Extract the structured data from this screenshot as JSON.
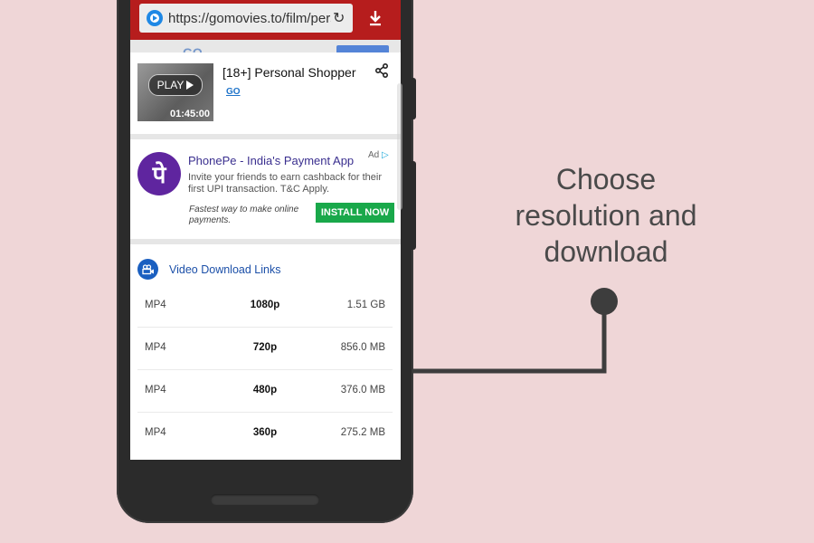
{
  "browser": {
    "url": "https://gomovies.to/film/pers"
  },
  "movie": {
    "title": "[18+] Personal Shopper",
    "play_label": "PLAY",
    "duration": "01:45:00",
    "link_label": "GO"
  },
  "ad": {
    "logo_text": "पे",
    "title": "PhonePe - India's Payment App",
    "badge": "Ad",
    "body": "Invite your friends to earn cashback for their first UPI transaction. T&C Apply.",
    "tagline": "Fastest way to make online payments.",
    "cta": "INSTALL NOW",
    "brand_color": "#5f259f",
    "cta_color": "#19a84a"
  },
  "downloads": {
    "heading": "Video Download Links",
    "rows": [
      {
        "format": "MP4",
        "resolution": "1080p",
        "size": "1.51 GB"
      },
      {
        "format": "MP4",
        "resolution": "720p",
        "size": "856.0 MB"
      },
      {
        "format": "MP4",
        "resolution": "480p",
        "size": "376.0 MB"
      },
      {
        "format": "MP4",
        "resolution": "360p",
        "size": "275.2 MB"
      }
    ]
  },
  "annotation": {
    "line1": "Choose",
    "line2": "resolution and",
    "line3": "download"
  },
  "colors": {
    "background": "#efd6d7",
    "browser_bar": "#b61d1d",
    "link": "#1b4fa8"
  }
}
